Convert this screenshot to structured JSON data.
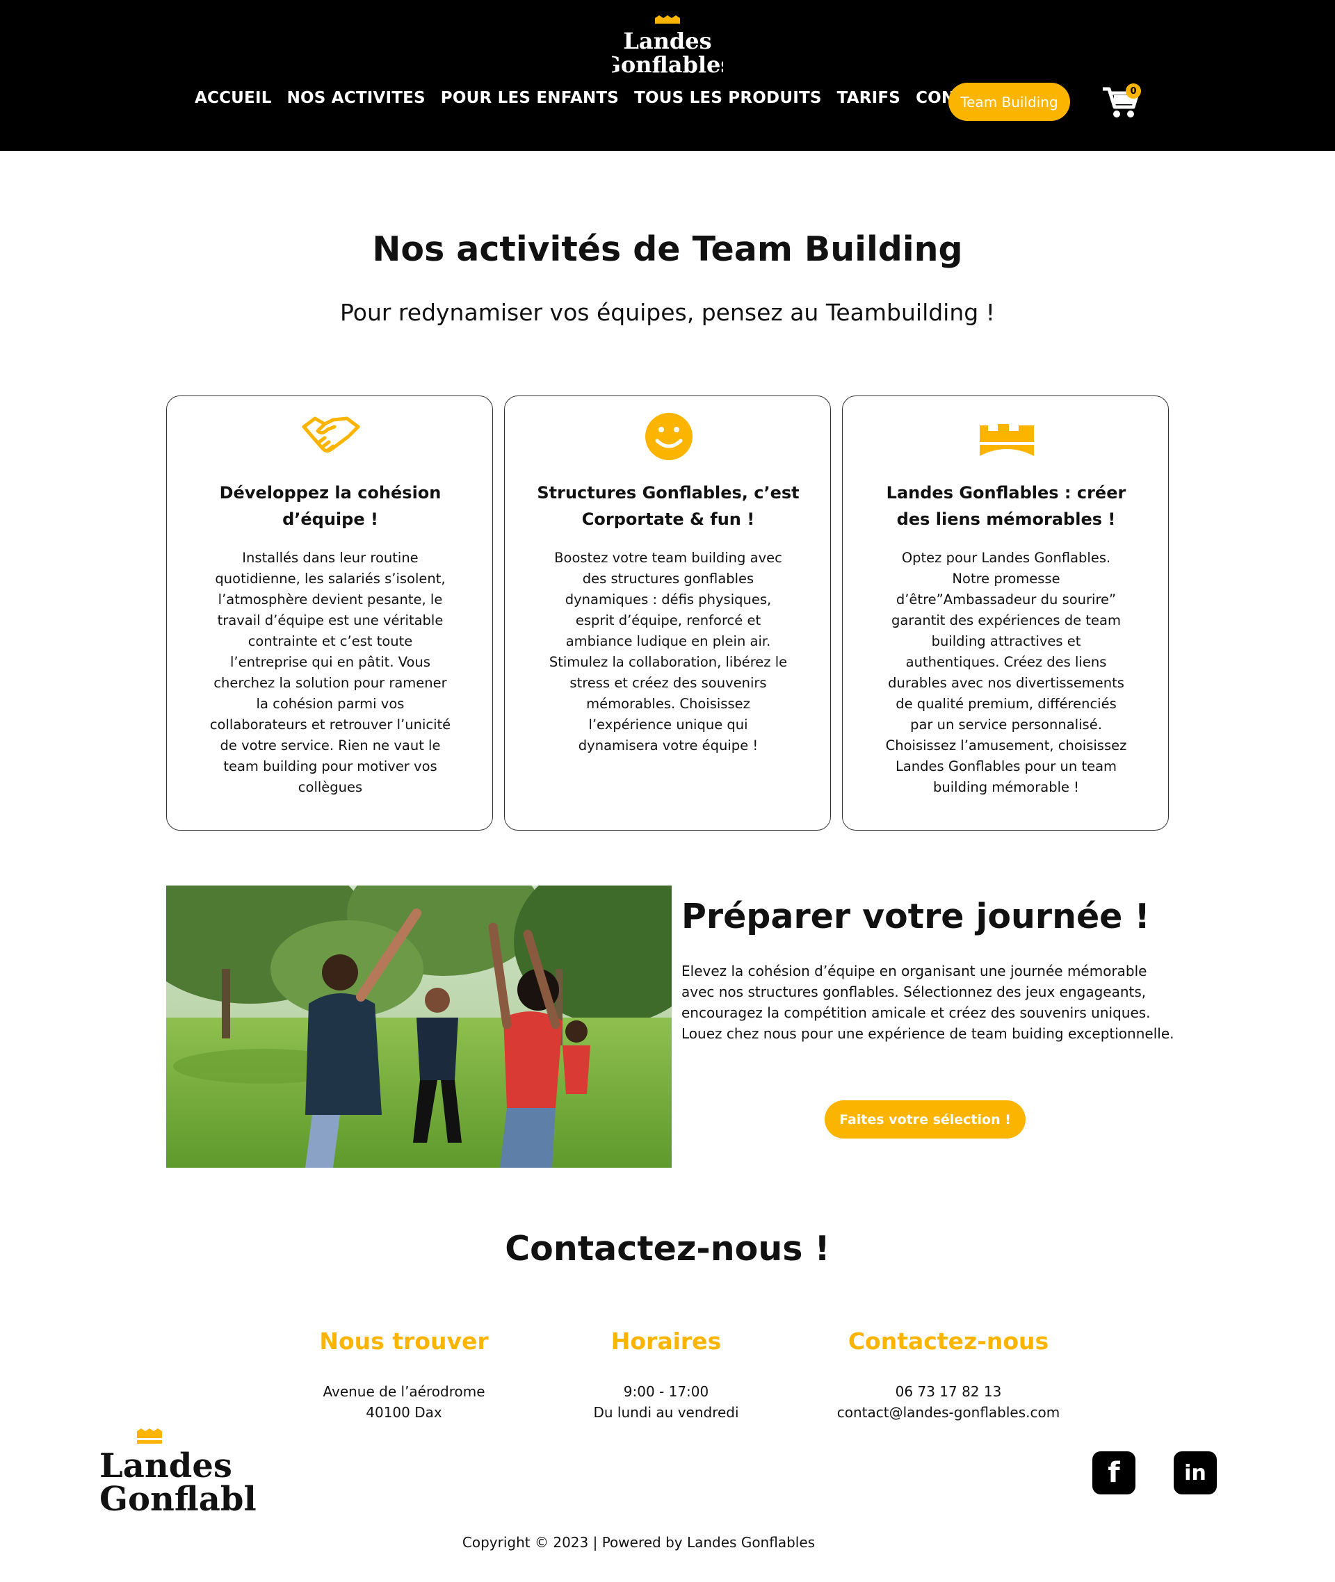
{
  "brand": {
    "line1": "Landes",
    "line2": "Gonflables",
    "accent": "#fbb400"
  },
  "nav": {
    "items": [
      "ACCUEIL",
      "NOS ACTIVITES",
      "POUR LES ENFANTS",
      "TOUS LES PRODUITS",
      "TARIFS",
      "CONTACT"
    ],
    "cta": "Team Building",
    "cart_count": "0"
  },
  "hero": {
    "title": "Nos activités de Team Building",
    "subtitle": "Pour redynamiser vos équipes, pensez au Teambuilding !"
  },
  "cards": [
    {
      "icon": "handshake-icon",
      "title": "Développez la cohésion d’équipe !",
      "text": "Installés dans leur routine quotidienne, les salariés s’isolent, l’atmosphère devient pesante, le travail d’équipe est une véritable contrainte et c’est toute l’entreprise qui en pâtit. Vous cherchez la solution pour ramener la cohésion parmi vos collaborateurs et retrouver l’unicité de votre service. Rien ne vaut le team building pour motiver vos collègues"
    },
    {
      "icon": "smiley-icon",
      "title": "Structures Gonflables, c’est Corportate & fun !",
      "text": "Boostez votre team building avec des structures gonflables dynamiques : défis physiques, esprit d’équipe, renforcé et ambiance ludique en plein air. Stimulez la collaboration, libérez le stress et créez des souvenirs mémorables. Choisissez l’expérience unique qui dynamisera votre équipe !"
    },
    {
      "icon": "crown-icon",
      "title": "Landes Gonflables : créer des liens mémorables !",
      "text": "Optez pour Landes Gonflables. Notre promesse d’être”Ambassadeur du sourire” garantit des expériences de team building attractives et authentiques. Créez des liens durables avec nos divertissements de qualité premium, différenciés par un service personnalisé. Choisissez l’amusement, choisissez Landes Gonflables pour un team building mémorable !"
    }
  ],
  "prepare": {
    "title": "Préparer votre journée !",
    "text": "Elevez la cohésion d’équipe en organisant une journée mémorable avec nos structures gonflables. Sélectionnez des jeux engageants, encouragez la compétition amicale et créez des souvenirs uniques. Louez chez nous pour une expérience de team buiding exceptionnelle.",
    "button": "Faites votre sélection !"
  },
  "contact": {
    "title": "Contactez-nous !",
    "columns": [
      {
        "heading": "Nous trouver",
        "line1": "Avenue de l’aérodrome",
        "line2": "40100 Dax"
      },
      {
        "heading": "Horaires",
        "line1": "9:00 - 17:00",
        "line2": "Du lundi au vendredi"
      },
      {
        "heading": "Contactez-nous",
        "line1": "06 73 17 82 13",
        "line2": "contact@landes-gonflables.com"
      }
    ]
  },
  "social": {
    "facebook": "f",
    "linkedin": "in"
  },
  "footer": {
    "copyright": "Copyright © 2023 | Powered by Landes Gonflables"
  }
}
